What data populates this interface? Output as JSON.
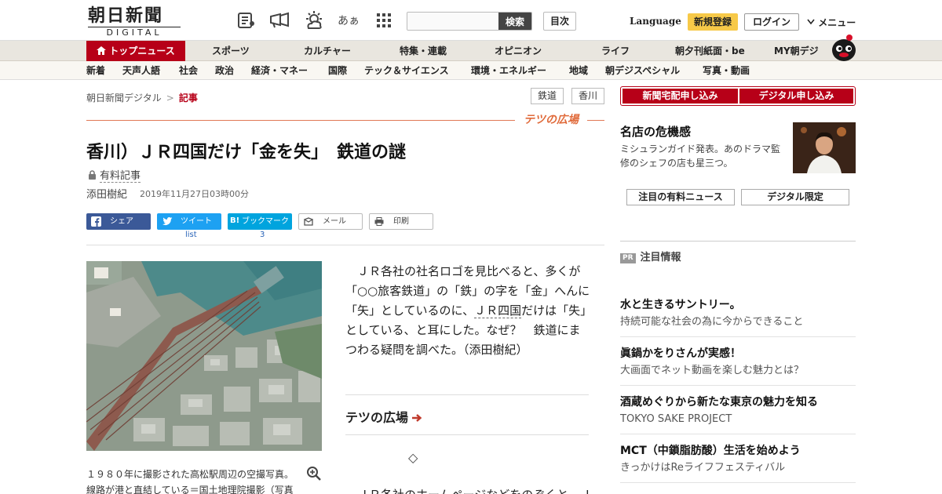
{
  "header": {
    "logo_main": "朝日新聞",
    "logo_sub": "DIGITAL",
    "search_button": "検索",
    "search_placeholder": "",
    "mokuji": "目次",
    "language": "Language",
    "register": "新規登録",
    "login": "ログイン",
    "menu": "メニュー",
    "font_size_label": "あぁ"
  },
  "nav_primary": [
    {
      "label": "トップニュース"
    },
    {
      "label": "スポーツ"
    },
    {
      "label": "カルチャー"
    },
    {
      "label": "特集・連載"
    },
    {
      "label": "オピニオン"
    },
    {
      "label": "ライフ"
    },
    {
      "label": "朝夕刊紙面・be"
    },
    {
      "label": "MY朝デジ"
    }
  ],
  "nav_secondary": [
    {
      "label": "新着"
    },
    {
      "label": "天声人語"
    },
    {
      "label": "社会"
    },
    {
      "label": "政治"
    },
    {
      "label": "経済・マネー"
    },
    {
      "label": "国際"
    },
    {
      "label": "テック＆サイエンス"
    },
    {
      "label": "環境・エネルギー"
    },
    {
      "label": "地域"
    },
    {
      "label": "朝デジスペシャル"
    },
    {
      "label": "写真・動画"
    }
  ],
  "breadcrumb": {
    "home": "朝日新聞デジタル",
    "sep": ">",
    "current": "記事"
  },
  "tags": [
    "鉄道",
    "香川"
  ],
  "series_badge": "テツの広場",
  "article": {
    "title": "香川）ＪＲ四国だけ「金を失」　鉄道の謎",
    "paid_label": "有料記事",
    "author": "添田樹紀",
    "date": "2019年11月27日03時00分",
    "lead_before": "　ＪＲ各社の社名ロゴを見比べると、多くが「○○旅客鉄道」の「鉄」の字を「金」へんに「矢」としているのに、",
    "lead_highlight": "ＪＲ四国",
    "lead_after": "だけは「失」としている、と耳にした。なぜ？　鉄道にまつわる疑問を調べた。（添田樹紀）",
    "series_link": "テツの広場",
    "diamond": "◇",
    "next_text": "　ＪＲ各社のホームページなどをのぞくと、Ｊ",
    "caption": "１９８０年に撮影された高松駅周辺の空撮写真。線路が港と直結している＝国土地理院撮影（写真"
  },
  "share": {
    "facebook": "シェア",
    "twitter": "ツイート",
    "twitter_count": "list",
    "hatena": "ブックマーク",
    "hatena_count": "3",
    "mail": "メール",
    "print": "印刷"
  },
  "sidebar": {
    "subscribe_paper": "新聞宅配申し込み",
    "subscribe_digital": "デジタル申し込み",
    "promo_title": "名店の危機感",
    "promo_text": "ミシュランガイド発表。あのドラマ監修のシェフの店も星三つ。",
    "pick_paid": "注目の有料ニュース",
    "pick_digital": "デジタル限定",
    "pr_badge": "PR",
    "pr_title": "注目情報",
    "ads": [
      {
        "title": "水と生きるサントリー。",
        "sub": "持続可能な社会の為に今からできること"
      },
      {
        "title": "眞鍋かをりさんが実感！",
        "sub": "大画面でネット動画を楽しむ魅力とは？"
      },
      {
        "title": "酒蔵めぐりから新たな東京の魅力を知る",
        "sub": "TOKYO SAKE PROJECT"
      },
      {
        "title": "MCT（中鎖脂肪酸）生活を始めよう",
        "sub": "きっかけはReライフフェスティバル"
      }
    ]
  },
  "colors": {
    "brand_red": "#b70018",
    "series_orange": "#e06a3a",
    "facebook": "#3b5998",
    "twitter": "#1da1f2",
    "hatena": "#00a4de",
    "register": "#f7c948"
  },
  "icons": [
    "paper-icon",
    "megaphone-icon",
    "weather-icon",
    "grid-icon",
    "lock-icon",
    "zoom-icon",
    "arrow-right-icon",
    "chevron-down-icon",
    "mascot-icon"
  ]
}
